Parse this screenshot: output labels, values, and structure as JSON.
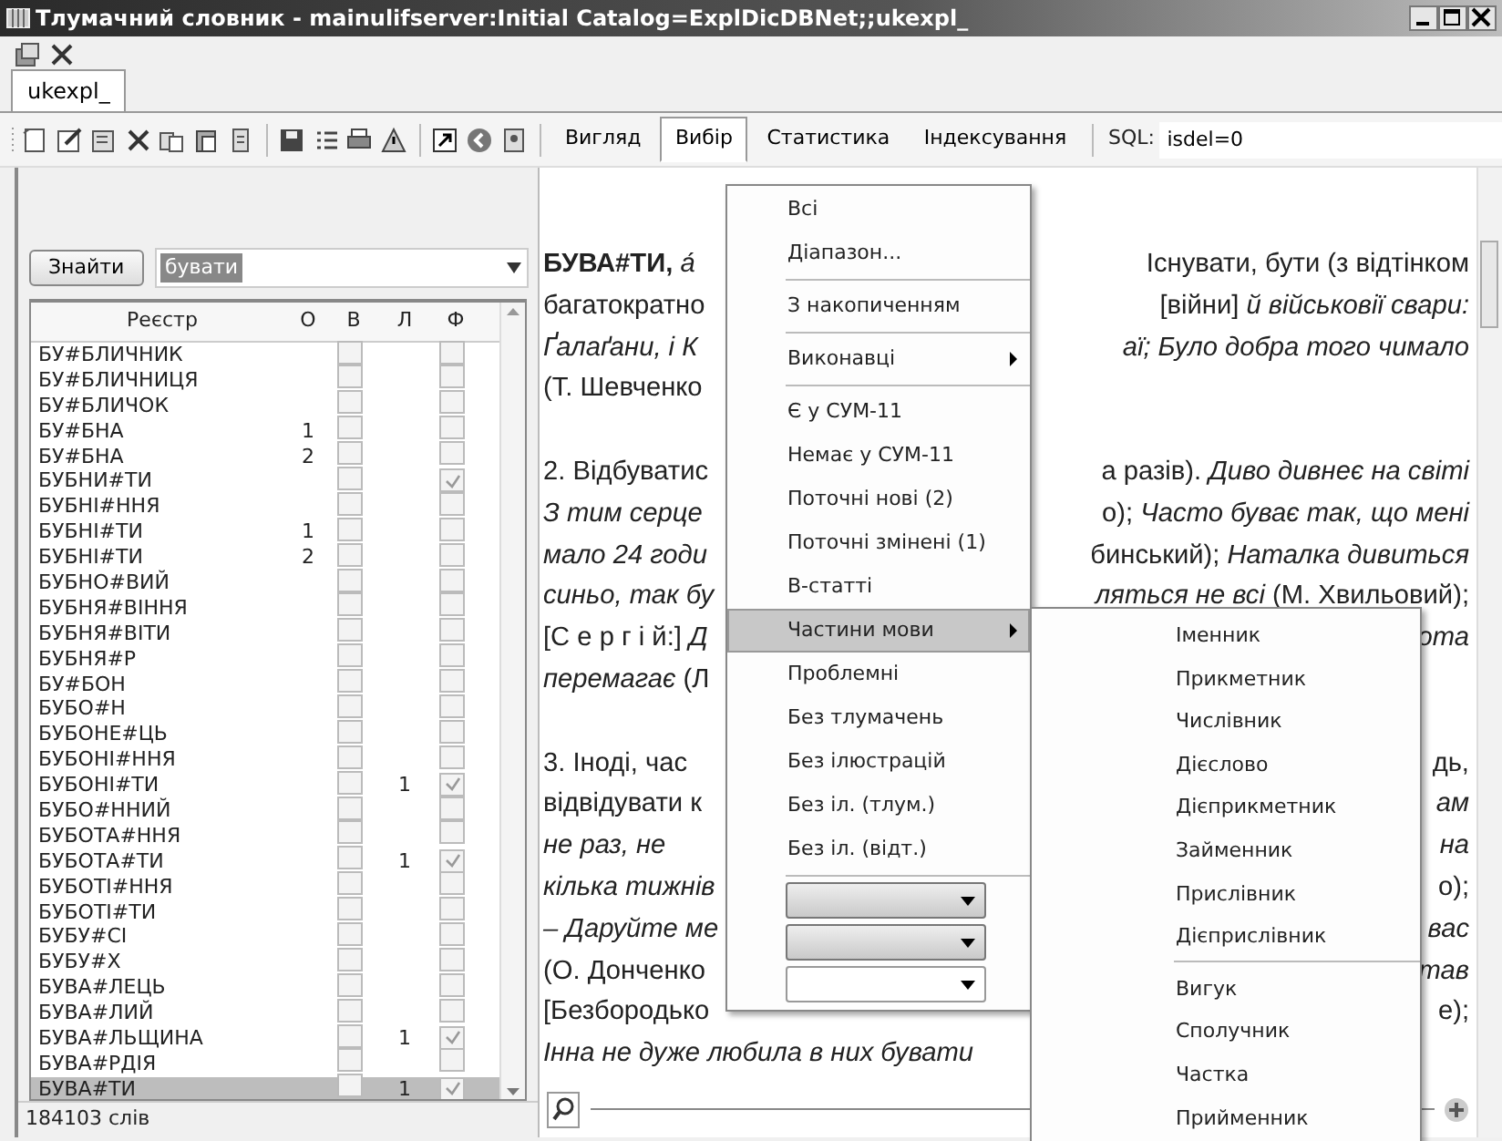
{
  "window": {
    "title": "Тлумачний словник - mainulifserver:Initial Catalog=ExplDicDBNet;;ukexpl_"
  },
  "tabs": [
    {
      "label": "ukexpl_",
      "selected": true
    }
  ],
  "toolbar": {
    "menus": [
      {
        "label": "Вигляд",
        "selected": false
      },
      {
        "label": "Вибір",
        "selected": true
      },
      {
        "label": "Статистика",
        "selected": false
      },
      {
        "label": "Індексування",
        "selected": false
      }
    ],
    "sql_label": "SQL:",
    "sql_value": "isdel=0"
  },
  "search": {
    "button": "Знайти",
    "value": "бувати"
  },
  "grid": {
    "columns": [
      "Реєстр",
      "О",
      "В",
      "Л",
      "Ф"
    ],
    "rows": [
      {
        "word": "БУ#БЛИЧНИК",
        "v_checked": false,
        "f_checked": false,
        "selected": false
      },
      {
        "word": "БУ#БЛИЧНИЦЯ",
        "v_checked": false,
        "f_checked": false,
        "selected": false
      },
      {
        "word": "БУ#БЛИЧОК",
        "v_checked": false,
        "f_checked": false,
        "selected": false
      },
      {
        "word": "БУ#БНА",
        "o": "1",
        "v_checked": false,
        "f_checked": false,
        "selected": false
      },
      {
        "word": "БУ#БНА",
        "o": "2",
        "v_checked": false,
        "f_checked": false,
        "selected": false
      },
      {
        "word": "БУБНИ#ТИ",
        "v_checked": false,
        "f_checked": true,
        "selected": false
      },
      {
        "word": "БУБНІ#ННЯ",
        "v_checked": false,
        "f_checked": false,
        "selected": false
      },
      {
        "word": "БУБНІ#ТИ",
        "o": "1",
        "v_checked": false,
        "f_checked": false,
        "selected": false
      },
      {
        "word": "БУБНІ#ТИ",
        "o": "2",
        "v_checked": false,
        "f_checked": false,
        "selected": false
      },
      {
        "word": "БУБНО#ВИЙ",
        "v_checked": false,
        "f_checked": false,
        "selected": false
      },
      {
        "word": "БУБНЯ#ВІННЯ",
        "v_checked": false,
        "f_checked": false,
        "selected": false
      },
      {
        "word": "БУБНЯ#ВІТИ",
        "v_checked": false,
        "f_checked": false,
        "selected": false
      },
      {
        "word": "БУБНЯ#Р",
        "v_checked": false,
        "f_checked": false,
        "selected": false
      },
      {
        "word": "БУ#БОН",
        "v_checked": false,
        "f_checked": false,
        "selected": false
      },
      {
        "word": "БУБО#Н",
        "v_checked": false,
        "f_checked": false,
        "selected": false
      },
      {
        "word": "БУБОНЕ#ЦЬ",
        "v_checked": false,
        "f_checked": false,
        "selected": false
      },
      {
        "word": "БУБОНІ#ННЯ",
        "v_checked": false,
        "f_checked": false,
        "selected": false
      },
      {
        "word": "БУБОНІ#ТИ",
        "l": "1",
        "v_checked": false,
        "f_checked": true,
        "selected": false
      },
      {
        "word": "БУБО#ННИЙ",
        "v_checked": false,
        "f_checked": false,
        "selected": false
      },
      {
        "word": "БУБОТА#ННЯ",
        "v_checked": false,
        "f_checked": false,
        "selected": false
      },
      {
        "word": "БУБОТА#ТИ",
        "l": "1",
        "v_checked": false,
        "f_checked": true,
        "selected": false
      },
      {
        "word": "БУБОТІ#ННЯ",
        "v_checked": false,
        "f_checked": false,
        "selected": false
      },
      {
        "word": "БУБОТІ#ТИ",
        "v_checked": false,
        "f_checked": false,
        "selected": false
      },
      {
        "word": "БУБУ#СІ",
        "v_checked": false,
        "f_checked": false,
        "selected": false
      },
      {
        "word": "БУБУ#Х",
        "v_checked": false,
        "f_checked": false,
        "selected": false
      },
      {
        "word": "БУВА#ЛЕЦЬ",
        "v_checked": false,
        "f_checked": false,
        "selected": false
      },
      {
        "word": "БУВА#ЛИЙ",
        "v_checked": false,
        "f_checked": false,
        "selected": false
      },
      {
        "word": "БУВА#ЛЬЩИНА",
        "l": "1",
        "v_checked": false,
        "f_checked": true,
        "selected": false
      },
      {
        "word": "БУВА#РДІЯ",
        "v_checked": false,
        "f_checked": false,
        "selected": false
      },
      {
        "word": "БУВА#ТИ",
        "l": "1",
        "v_checked": false,
        "f_checked": true,
        "selected": true
      }
    ]
  },
  "status_bar": "184103 слів",
  "article": {
    "lines": [
      {
        "kind": "text",
        "left": "**БУВА#ТИ,** *а́*",
        "right": "Існувати, бути (з відтінком"
      },
      {
        "kind": "text",
        "left": "багатократно",
        "right": "[війни] *й військовії свари:*"
      },
      {
        "kind": "text",
        "left": "*Ґалаґани, і К*",
        "right": "*аї; Було добра того чимало*"
      },
      {
        "kind": "text",
        "left": "(Т. Шевченко"
      },
      {
        "kind": "gap"
      },
      {
        "kind": "text",
        "left": "2. Відбуватис",
        "right": "а разів). *Диво дивнеє на світі*"
      },
      {
        "kind": "text",
        "left": "*З тим серце*",
        "right": "о); *Часто буває так, що мені*"
      },
      {
        "kind": "text",
        "left": "*мало 24 годи*",
        "right": "бинський); *Наталка дивиться*"
      },
      {
        "kind": "text",
        "left": "*синьо, так бу*",
        "right": "*ляться не всі* (М. Хвильовий);"
      },
      {
        "kind": "text",
        "left": "[С е р г і й:] *Д*",
        "right": "*ота*"
      },
      {
        "kind": "text",
        "left": "*перемагає* (Л"
      },
      {
        "kind": "gap"
      },
      {
        "kind": "text",
        "left": "3. Іноді, час",
        "right": "дь,"
      },
      {
        "kind": "text",
        "left": "відвідувати к",
        "right": "*ам*"
      },
      {
        "kind": "text",
        "left": "*не раз, не*",
        "right": "*на*"
      },
      {
        "kind": "text",
        "left": "*кілька тижнів*",
        "right": "о);"
      },
      {
        "kind": "text",
        "left": "*– Даруйте ме*",
        "right": "*вас*"
      },
      {
        "kind": "text",
        "left": "(О. Донченко",
        "right": "*тав*"
      },
      {
        "kind": "text",
        "left": "[Безбородько",
        "right": "е);"
      },
      {
        "kind": "text",
        "left": "*Інна не дуже любила в них бувати*"
      }
    ]
  },
  "menu": {
    "items": [
      {
        "kind": "item",
        "label": "Всі",
        "submenu": false,
        "selected": false
      },
      {
        "kind": "item",
        "label": "Діапазон...",
        "submenu": false,
        "selected": false
      },
      {
        "kind": "separator"
      },
      {
        "kind": "item",
        "label": "З накопиченням",
        "submenu": false,
        "selected": false
      },
      {
        "kind": "separator"
      },
      {
        "kind": "item",
        "label": "Виконавці",
        "submenu": true,
        "selected": false
      },
      {
        "kind": "separator"
      },
      {
        "kind": "item",
        "label": "Є у СУМ-11",
        "submenu": false,
        "selected": false
      },
      {
        "kind": "item",
        "label": "Немає у СУМ-11",
        "submenu": false,
        "selected": false
      },
      {
        "kind": "item",
        "label": "Поточні нові (2)",
        "submenu": false,
        "selected": false
      },
      {
        "kind": "item",
        "label": "Поточні змінені (1)",
        "submenu": false,
        "selected": false
      },
      {
        "kind": "item",
        "label": "В-статті",
        "submenu": false,
        "selected": false
      },
      {
        "kind": "item",
        "label": "Частини мови",
        "submenu": true,
        "selected": true
      },
      {
        "kind": "item",
        "label": "Проблемні",
        "submenu": false,
        "selected": false
      },
      {
        "kind": "item",
        "label": "Без тлумачень",
        "submenu": false,
        "selected": false
      },
      {
        "kind": "item",
        "label": "Без ілюстрацій",
        "submenu": false,
        "selected": false
      },
      {
        "kind": "item",
        "label": "Без іл. (тлум.)",
        "submenu": false,
        "selected": false
      },
      {
        "kind": "item",
        "label": "Без іл. (відт.)",
        "submenu": false,
        "selected": false
      },
      {
        "kind": "separator"
      },
      {
        "kind": "combo",
        "disabled": true
      },
      {
        "kind": "combo",
        "disabled": true
      },
      {
        "kind": "combo",
        "disabled": false
      }
    ]
  },
  "submenu": {
    "items": [
      {
        "kind": "item",
        "label": "Іменник"
      },
      {
        "kind": "item",
        "label": "Прикметник"
      },
      {
        "kind": "item",
        "label": "Числівник"
      },
      {
        "kind": "item",
        "label": "Дієслово"
      },
      {
        "kind": "item",
        "label": "Дієприкметник"
      },
      {
        "kind": "item",
        "label": "Займенник"
      },
      {
        "kind": "item",
        "label": "Прислівник"
      },
      {
        "kind": "item",
        "label": "Дієприслівник"
      },
      {
        "kind": "separator"
      },
      {
        "kind": "item",
        "label": "Вигук"
      },
      {
        "kind": "item",
        "label": "Сполучник"
      },
      {
        "kind": "item",
        "label": "Частка"
      },
      {
        "kind": "item",
        "label": "Прийменник"
      }
    ]
  }
}
